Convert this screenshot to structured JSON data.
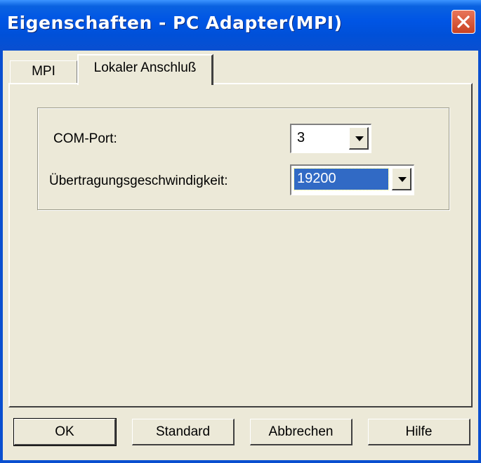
{
  "window": {
    "title": "Eigenschaften - PC Adapter(MPI)",
    "titlebar_color": "#0055e5",
    "close_icon": "close-icon"
  },
  "tabs": [
    {
      "label": "MPI",
      "active": false
    },
    {
      "label": "Lokaler Anschluß",
      "active": true
    }
  ],
  "settings": {
    "com_port": {
      "label": "COM-Port:",
      "value": "3"
    },
    "speed": {
      "label": "Übertragungsgeschwindigkeit:",
      "value": "19200",
      "selected": true
    }
  },
  "buttons": {
    "ok": "OK",
    "standard": "Standard",
    "cancel": "Abbrechen",
    "help": "Hilfe"
  },
  "colors": {
    "face": "#ece9d8",
    "selection": "#316ac5"
  }
}
